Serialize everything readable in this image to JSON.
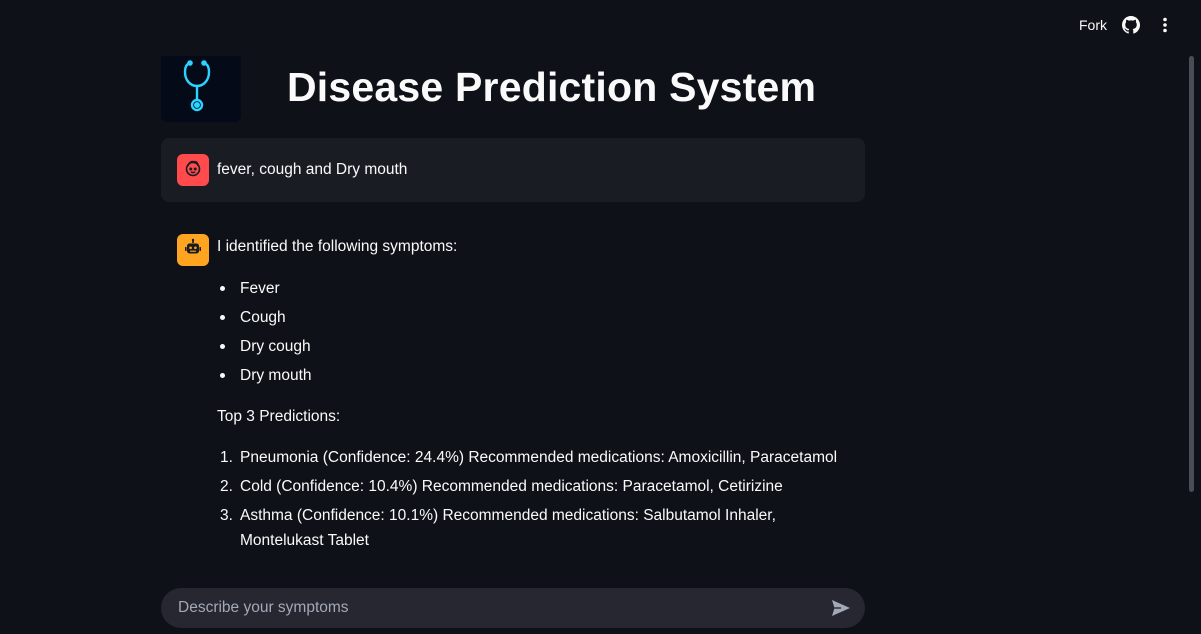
{
  "toolbar": {
    "fork_label": "Fork",
    "github_icon": "github-icon",
    "menu_icon": "kebab-menu-icon"
  },
  "header": {
    "logo_icon": "stethoscope-icon",
    "title": "Disease Prediction System"
  },
  "chat": {
    "user_message": {
      "avatar_icon": "user-face-icon",
      "text": "fever, cough and Dry mouth"
    },
    "bot_message": {
      "avatar_icon": "robot-icon",
      "intro": "I identified the following symptoms:",
      "symptoms": [
        "Fever",
        "Cough",
        "Dry cough",
        "Dry mouth"
      ],
      "predictions_heading": "Top 3 Predictions:",
      "predictions": [
        {
          "num": "1.",
          "text": "Pneumonia (Confidence: 24.4%) Recommended medications: Amoxicillin, Paracetamol"
        },
        {
          "num": "2.",
          "text": "Cold (Confidence: 10.4%) Recommended medications: Paracetamol, Cetirizine"
        },
        {
          "num": "3.",
          "text": "Asthma (Confidence: 10.1%) Recommended medications: Salbutamol Inhaler, Montelukast Tablet"
        }
      ]
    }
  },
  "input": {
    "placeholder": "Describe your symptoms",
    "value": "",
    "send_icon": "send-icon"
  },
  "colors": {
    "background": "#0e1117",
    "user_avatar": "#ff4b4b",
    "bot_avatar": "#ffa421",
    "message_bg": "#1a1c24",
    "input_bg": "#262730",
    "logo_glow": "#2ad4ff"
  }
}
